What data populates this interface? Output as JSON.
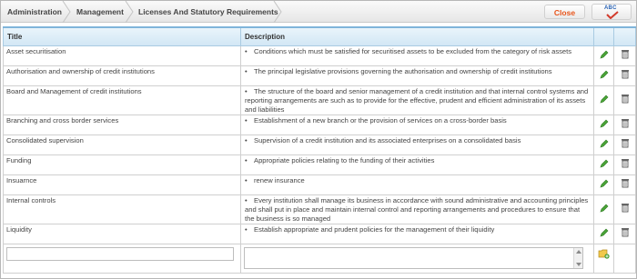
{
  "breadcrumb": [
    "Administration",
    "Management",
    "Licenses And Statutory Requirements"
  ],
  "toolbar": {
    "close_label": "Close",
    "spellcheck_label": "ABC"
  },
  "table": {
    "headers": {
      "title": "Title",
      "description": "Description"
    },
    "rows": [
      {
        "title": "Asset securitisation",
        "description": "Conditions which must be satisfied for securitised assets to be excluded from the category of risk assets"
      },
      {
        "title": "Authorisation and ownership of credit institutions",
        "description": "The principal legislative provisions governing the authorisation and ownership of credit institutions"
      },
      {
        "title": "Board and Management of credit institutions",
        "description": "The structure of the board and senior management of a credit institution and that internal control systems and reporting arrangements are such as to provide for the effective, prudent and efficient administration of its assets and liabilities"
      },
      {
        "title": "Branching and cross border services",
        "description": "Establishment of a new branch or the provision of services on a cross-border basis"
      },
      {
        "title": "Consolidated supervision",
        "description": "Supervision of a credit institution and its associated enterprises on a consolidated basis"
      },
      {
        "title": "Funding",
        "description": "Appropriate policies relating to the funding of their activities"
      },
      {
        "title": "Insuarnce",
        "description": "renew insurance"
      },
      {
        "title": "Internal controls",
        "description": "Every institution shall manage its business in accordance with sound administrative and accounting principles and shall put in place and maintain internal control and reporting arrangements and procedures to ensure that the business is so managed"
      },
      {
        "title": "Liquidity",
        "description": "Establish appropriate and prudent policies for the management of their liquidity"
      }
    ],
    "new_row": {
      "title_value": "",
      "description_value": ""
    }
  },
  "icons": {
    "edit": "pencil-icon",
    "delete": "trash-icon",
    "add": "add-folder-icon",
    "spellcheck": "spellcheck-icon"
  },
  "colors": {
    "header_bg": "#d2e7f5",
    "header_border": "#7fb4da",
    "close_text": "#e8541a",
    "pencil": "#3f9a2e"
  }
}
